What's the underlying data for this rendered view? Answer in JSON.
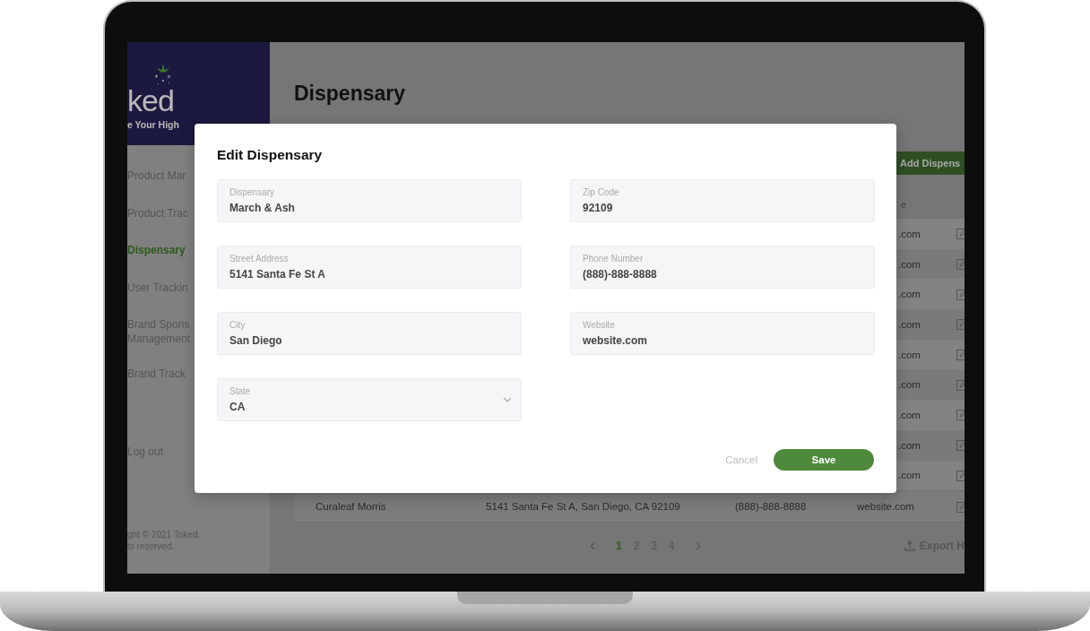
{
  "sidebar": {
    "logo": "ked",
    "tagline": "e Your High",
    "items": [
      {
        "label": "Product Mar",
        "selected": false
      },
      {
        "label": "Product Trac",
        "selected": false
      },
      {
        "label": "Dispensary",
        "selected": true
      },
      {
        "label": "User Trackin",
        "selected": false
      },
      {
        "label": "Brand Spons Management",
        "selected": false
      },
      {
        "label": "Brand Track",
        "selected": false
      }
    ],
    "logout": "Log out",
    "copyright": "ght © 2021 Toked.\nts reserved."
  },
  "main": {
    "title": "Dispensary",
    "add_button": "Add Dispens",
    "column_heading": "e",
    "rows": [
      {
        "website": ".com"
      },
      {
        "website": ".com"
      },
      {
        "website": ".com"
      },
      {
        "website": ".com"
      },
      {
        "website": ".com"
      },
      {
        "website": ".com"
      },
      {
        "website": ".com"
      },
      {
        "website": ".com"
      },
      {
        "website": ".com"
      },
      {
        "name": "Curaleaf Morris",
        "address": "5141 Santa Fe St A, San Diego, CA 92109",
        "phone": "(888)-888-8888",
        "website": "website.com"
      }
    ],
    "pagination": {
      "prev": "‹",
      "next": "›",
      "pages": [
        {
          "label": "1",
          "selected": true
        },
        {
          "label": "2",
          "selected": false
        },
        {
          "label": "3",
          "selected": false
        },
        {
          "label": "4",
          "selected": false
        }
      ]
    },
    "export": "Export H"
  },
  "modal": {
    "title": "Edit Dispensary",
    "fields": [
      {
        "label": "Dispensary",
        "value": "March & Ash",
        "kind": "text"
      },
      {
        "label": "Zip Code",
        "value": "92109",
        "kind": "text"
      },
      {
        "label": "Street Address",
        "value": "5141 Santa Fe St A",
        "kind": "text"
      },
      {
        "label": "Phone Number",
        "value": "(888)-888-8888",
        "kind": "text"
      },
      {
        "label": "City",
        "value": "San Diego",
        "kind": "text"
      },
      {
        "label": "Website",
        "value": "website.com",
        "kind": "text"
      },
      {
        "label": "State",
        "value": "CA",
        "kind": "select"
      }
    ],
    "cancel": "Cancel",
    "save": "Save"
  }
}
